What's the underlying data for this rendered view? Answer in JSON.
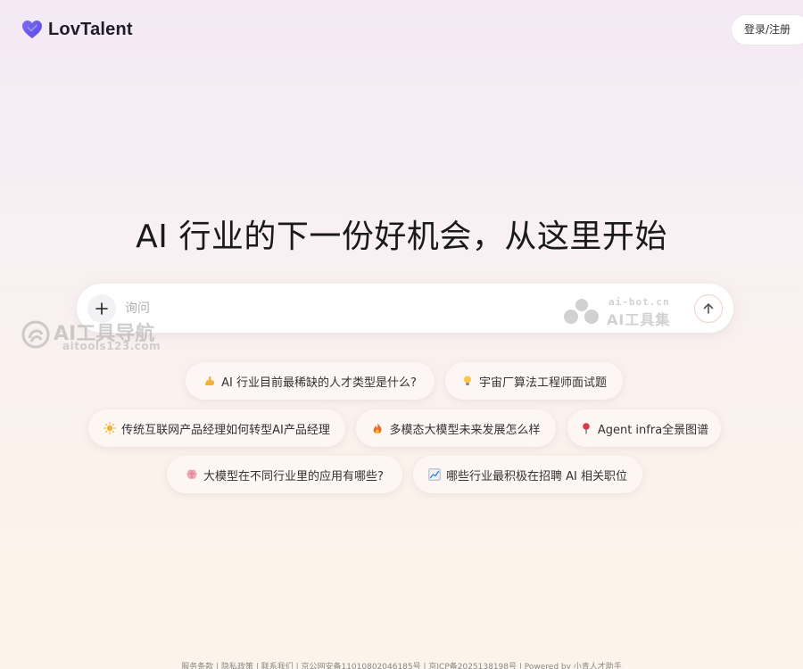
{
  "header": {
    "logo_text": "LovTalent",
    "login_label": "登录/注册"
  },
  "hero": {
    "headline": "AI 行业的下一份好机会，从这里开始"
  },
  "search": {
    "placeholder": "询问"
  },
  "suggestions": [
    {
      "icon": "flexed-arm-icon",
      "label": "AI 行业目前最稀缺的人才类型是什么?"
    },
    {
      "icon": "lightbulb-icon",
      "label": "宇宙厂算法工程师面试题"
    },
    {
      "icon": "sun-icon",
      "label": "传统互联网产品经理如何转型AI产品经理"
    },
    {
      "icon": "fire-icon",
      "label": "多模态大模型未来发展怎么样"
    },
    {
      "icon": "pin-icon",
      "label": "Agent infra全景图谱"
    },
    {
      "icon": "brain-icon",
      "label": "大模型在不同行业里的应用有哪些?"
    },
    {
      "icon": "chart-increasing-icon",
      "label": "哪些行业最积极在招聘 AI 相关职位"
    }
  ],
  "watermarks": {
    "right_url": "ai-bot.cn",
    "right_name": "AI工具集",
    "left_name": "AI工具导航",
    "left_url": "aitools123.com"
  },
  "footer": {
    "text": "服务条款 | 隐私政策 | 联系我们 | 京公网安备11010802046185号 | 京ICP备2025138198号 | Powered by 小青人才助手"
  },
  "colors": {
    "brand": "#6a5cf0",
    "send_border": "#f0cfc4"
  }
}
